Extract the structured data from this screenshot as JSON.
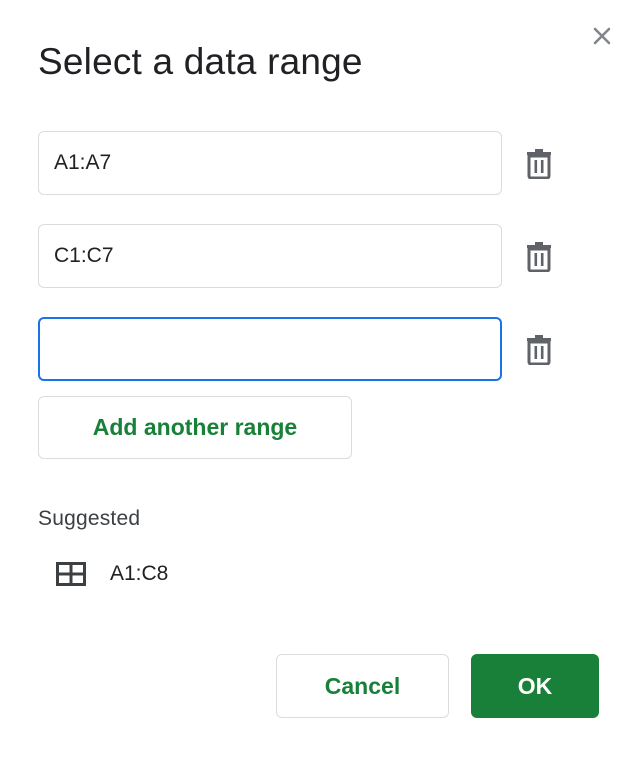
{
  "dialog": {
    "title": "Select a data range",
    "close_icon": "close-icon"
  },
  "ranges": [
    {
      "value": "A1:A7",
      "placeholder": "",
      "focused": false
    },
    {
      "value": "C1:C7",
      "placeholder": "",
      "focused": false
    },
    {
      "value": "",
      "placeholder": "",
      "focused": true
    }
  ],
  "add_range_label": "Add another range",
  "suggested": {
    "label": "Suggested",
    "items": [
      {
        "icon": "table-grid-icon",
        "range": "A1:C8"
      }
    ]
  },
  "buttons": {
    "cancel_label": "Cancel",
    "ok_label": "OK"
  },
  "colors": {
    "accent_green": "#188038",
    "focus_blue": "#1a73e8",
    "border_gray": "#dadce0",
    "icon_gray": "#5f6368"
  }
}
